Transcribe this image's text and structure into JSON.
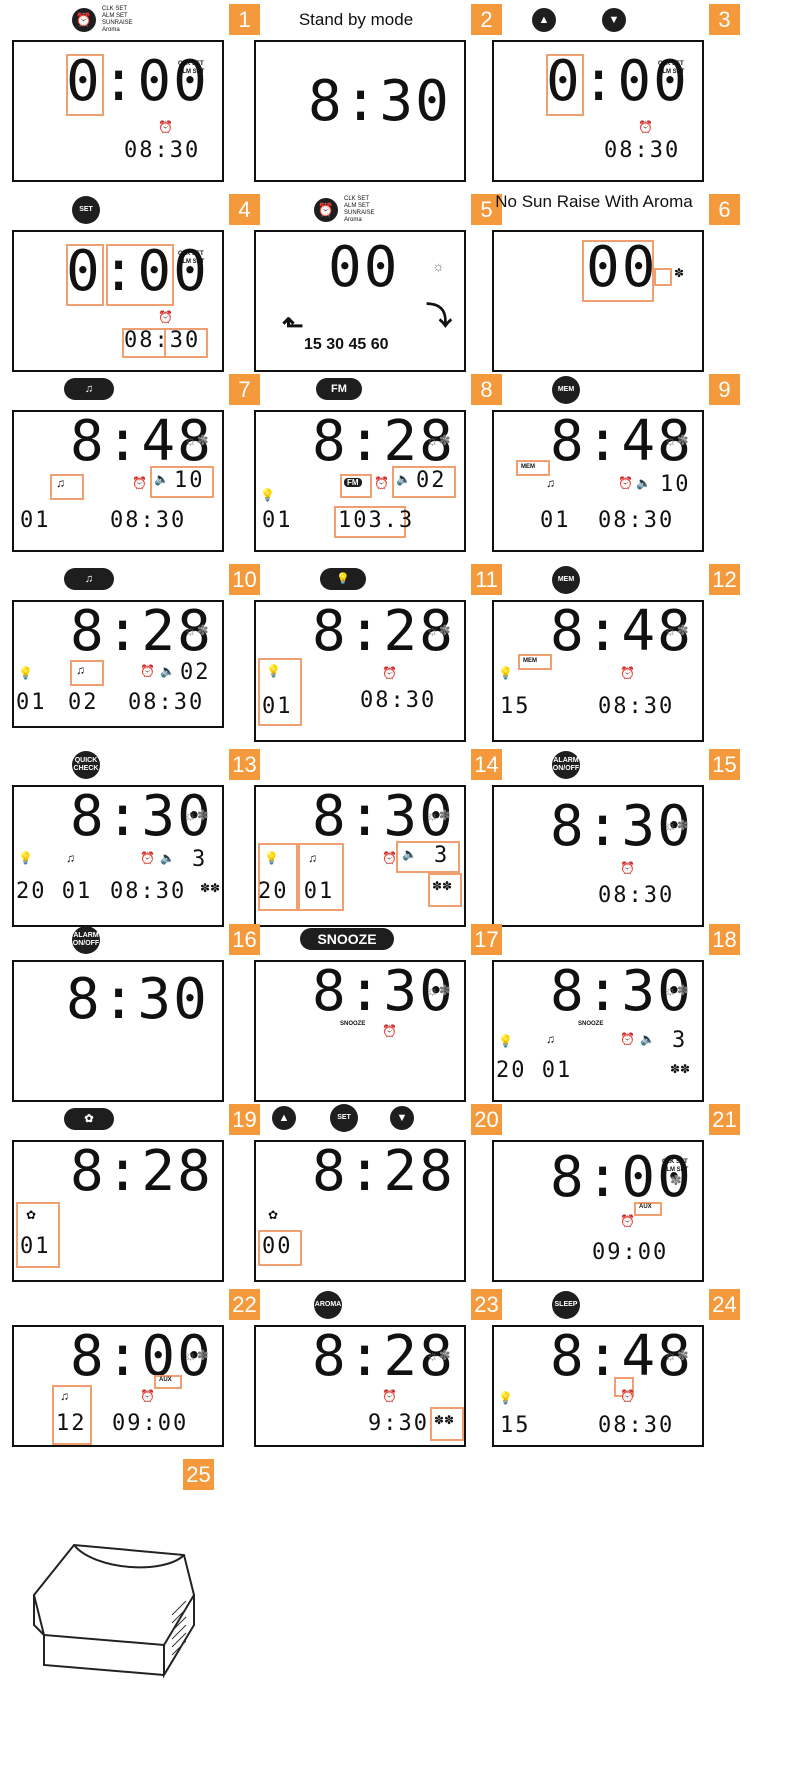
{
  "colors": {
    "accent": "#f49a3c",
    "highlight": "#f0a070",
    "lcd_border": "#111111"
  },
  "icons": [
    "alarm-clock-icon",
    "up-triangle-icon",
    "down-triangle-icon",
    "music-note-icon",
    "bulb-icon",
    "aroma-fan-icon",
    "sun-icon",
    "speaker-icon",
    "arrow-up-icon",
    "arrow-curve-icon"
  ],
  "mode_list": [
    "CLK SET",
    "ALM SET",
    "SUNRAISE",
    "Aroma"
  ],
  "panels": [
    {
      "n": "1",
      "big": "0:00",
      "small": "08:30",
      "tags": [
        "CLK SET",
        "ALM SET"
      ]
    },
    {
      "n": "2",
      "caption": "Stand by mode",
      "big": "8:30"
    },
    {
      "n": "3",
      "big": "0:00",
      "small": "08:30",
      "tags": [
        "CLK SET",
        "ALM SET"
      ]
    },
    {
      "n": "4",
      "btn": "SET",
      "big": "0:00",
      "small": "08:30",
      "tags": [
        "CLK SET",
        "ALM SET"
      ]
    },
    {
      "n": "5",
      "big": "00",
      "small": "15 30 45 60"
    },
    {
      "n": "6",
      "caption": "No Sun Raise With Aroma",
      "big": "00"
    },
    {
      "n": "7",
      "big": "8:48",
      "left": "01",
      "small": "08:30",
      "vol": "10"
    },
    {
      "n": "8",
      "btn": "FM",
      "big": "8:28",
      "left": "01",
      "small": "103.3",
      "vol": "02",
      "tag": "FM"
    },
    {
      "n": "9",
      "btn": "MEM",
      "big": "8:48",
      "left": "01",
      "small": "08:30",
      "vol": "10",
      "tag": "MEM"
    },
    {
      "n": "10",
      "big": "8:28",
      "left": "01",
      "mid": "02",
      "small": "08:30",
      "vol": "02"
    },
    {
      "n": "11",
      "big": "8:28",
      "left": "01",
      "small": "08:30"
    },
    {
      "n": "12",
      "btn": "MEM",
      "big": "8:48",
      "left": "15",
      "small": "08:30",
      "tag": "MEM"
    },
    {
      "n": "13",
      "btn": "QUICK CHECK",
      "big": "8:30",
      "left": "20 01",
      "small": "08:30",
      "vol": "3"
    },
    {
      "n": "14",
      "big": "8:30",
      "left": "20 01",
      "vol": "3"
    },
    {
      "n": "15",
      "btn": "ALARM ON/OFF",
      "big": "8:30",
      "small": "08:30"
    },
    {
      "n": "16",
      "btn": "ALARM ON/OFF",
      "big": "8:30"
    },
    {
      "n": "17",
      "btn": "SNOOZE",
      "big": "8:30",
      "tag": "SNOOZE"
    },
    {
      "n": "18",
      "big": "8:30",
      "left": "20 01",
      "vol": "3",
      "tag": "SNOOZE"
    },
    {
      "n": "19",
      "big": "8:28",
      "left": "01"
    },
    {
      "n": "20",
      "btn": "SET",
      "big": "8:28",
      "left": "00"
    },
    {
      "n": "21",
      "big": "8:00",
      "small": "09:00",
      "tags": [
        "CLK SET",
        "ALM SET"
      ],
      "tag": "AUX"
    },
    {
      "n": "22",
      "big": "8:00",
      "left": "12",
      "small": "09:00",
      "tag": "AUX"
    },
    {
      "n": "23",
      "btn": "AROMA",
      "big": "8:28",
      "small": "9:30"
    },
    {
      "n": "24",
      "btn": "SLEEP",
      "big": "8:48",
      "left": "15",
      "small": "08:30"
    },
    {
      "n": "25"
    }
  ]
}
